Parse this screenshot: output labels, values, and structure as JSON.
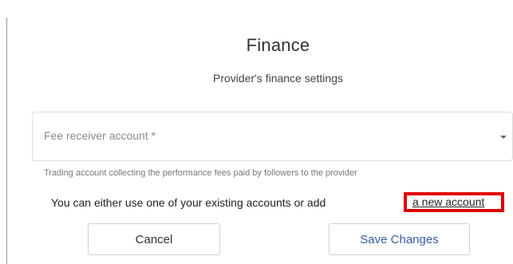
{
  "dialog": {
    "title": "Finance",
    "subtitle": "Provider's finance settings"
  },
  "fee_receiver": {
    "label": "Fee receiver account *",
    "value": "",
    "helper_text": "Trading account collecting the performance fees paid by followers to the provider"
  },
  "info": {
    "text": "You can either use one of your existing accounts or add",
    "link_label": "a new account",
    "highlight_color": "#e00000"
  },
  "actions": {
    "cancel_label": "Cancel",
    "save_label": "Save Changes",
    "save_color": "#3b5ba8"
  },
  "icons": {
    "dropdown": "chevron-down-icon"
  }
}
